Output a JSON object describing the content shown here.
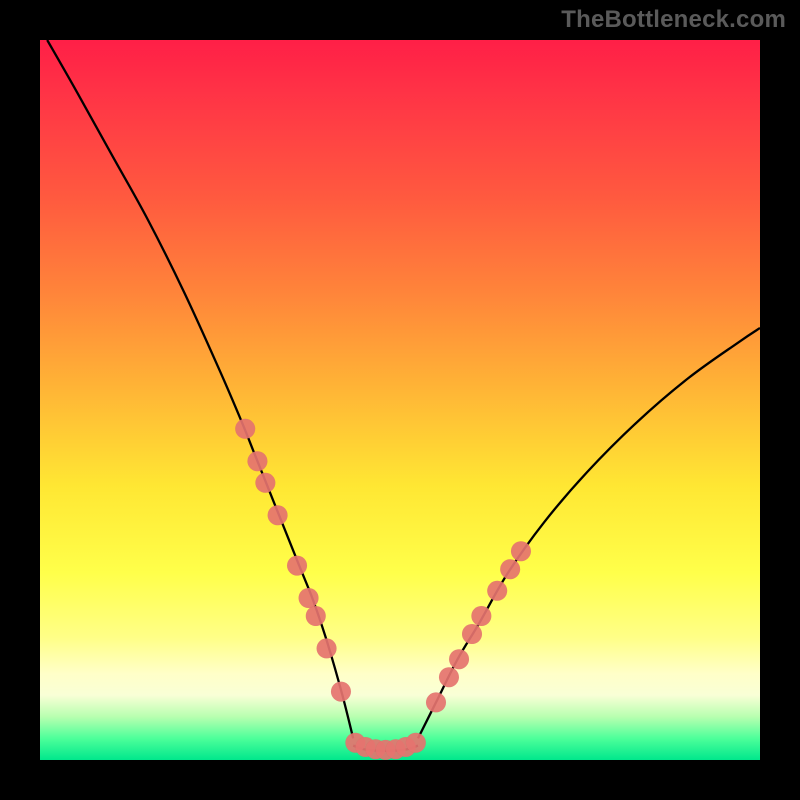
{
  "watermark": "TheBottleneck.com",
  "colors": {
    "frame": "#000000",
    "curve": "#000000",
    "marker": "#e5736f"
  },
  "chart_data": {
    "type": "line",
    "title": "",
    "xlabel": "",
    "ylabel": "",
    "x_range": [
      0,
      100
    ],
    "y_range": [
      0,
      100
    ],
    "note": "Two-branch V-shaped bottleneck curve on a vertical red→yellow→green gradient. X is a normalized hardware ratio; Y is bottleneck severity (0 best, 100 worst). Curve values estimated from pixel positions.",
    "series": [
      {
        "name": "left-branch",
        "x": [
          1,
          5,
          10,
          15,
          20,
          25,
          28,
          30,
          32,
          34,
          36,
          38,
          40,
          42,
          43.5
        ],
        "y": [
          100,
          93,
          84,
          75,
          65,
          54,
          47,
          42,
          37,
          32,
          27,
          22,
          16,
          9,
          3
        ]
      },
      {
        "name": "plateau",
        "x": [
          43.5,
          45,
          47,
          49,
          51,
          52.5
        ],
        "y": [
          2,
          1.5,
          1.3,
          1.3,
          1.5,
          2
        ]
      },
      {
        "name": "right-branch",
        "x": [
          52.5,
          55,
          58,
          61,
          65,
          70,
          76,
          83,
          90,
          97,
          100
        ],
        "y": [
          3,
          8,
          14,
          19,
          26,
          33,
          40,
          47,
          53,
          58,
          60
        ]
      }
    ],
    "markers_left": [
      {
        "x": 28.5,
        "y": 46
      },
      {
        "x": 30.2,
        "y": 41.5
      },
      {
        "x": 31.3,
        "y": 38.5
      },
      {
        "x": 33.0,
        "y": 34
      },
      {
        "x": 35.7,
        "y": 27
      },
      {
        "x": 37.3,
        "y": 22.5
      },
      {
        "x": 38.3,
        "y": 20
      },
      {
        "x": 39.8,
        "y": 15.5
      },
      {
        "x": 41.8,
        "y": 9.5
      }
    ],
    "markers_plateau": [
      {
        "x": 43.8,
        "y": 2.4
      },
      {
        "x": 45.2,
        "y": 1.8
      },
      {
        "x": 46.6,
        "y": 1.5
      },
      {
        "x": 48.0,
        "y": 1.4
      },
      {
        "x": 49.4,
        "y": 1.5
      },
      {
        "x": 50.8,
        "y": 1.8
      },
      {
        "x": 52.2,
        "y": 2.4
      }
    ],
    "markers_right": [
      {
        "x": 55.0,
        "y": 8
      },
      {
        "x": 56.8,
        "y": 11.5
      },
      {
        "x": 58.2,
        "y": 14
      },
      {
        "x": 60.0,
        "y": 17.5
      },
      {
        "x": 61.3,
        "y": 20
      },
      {
        "x": 63.5,
        "y": 23.5
      },
      {
        "x": 65.3,
        "y": 26.5
      },
      {
        "x": 66.8,
        "y": 29
      }
    ],
    "marker_radius": 10
  }
}
